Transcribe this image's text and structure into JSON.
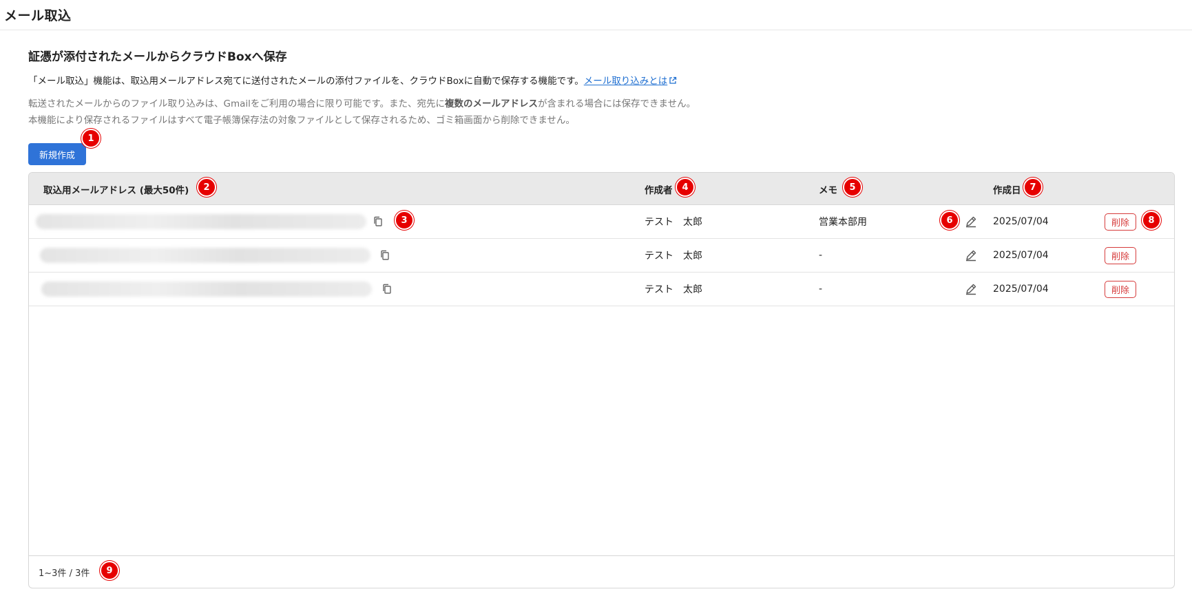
{
  "page": {
    "title": "メール取込"
  },
  "intro": {
    "heading": "証憑が添付されたメールからクラウドBoxへ保存",
    "description": "「メール取込」機能は、取込用メールアドレス宛てに送付されたメールの添付ファイルを、クラウドBoxに自動で保存する機能です。",
    "help_link": "メール取り込みとは",
    "note1_prefix": "転送されたメールからのファイル取り込みは、Gmailをご利用の場合に限り可能です。また、宛先に",
    "note1_bold": "複数のメールアドレス",
    "note1_suffix": "が含まれる場合には保存できません。",
    "note2": "本機能により保存されるファイルはすべて電子帳簿保存法の対象ファイルとして保存されるため、ゴミ箱画面から削除できません。"
  },
  "toolbar": {
    "new_label": "新規作成"
  },
  "table": {
    "headers": {
      "address": "取込用メールアドレス (最大50件)",
      "author": "作成者",
      "memo": "メモ",
      "date": "作成日"
    },
    "rows": [
      {
        "author": "テスト　太郎",
        "memo": "営業本部用",
        "date": "2025/07/04",
        "delete_label": "削除"
      },
      {
        "author": "テスト　太郎",
        "memo": "-",
        "date": "2025/07/04",
        "delete_label": "削除"
      },
      {
        "author": "テスト　太郎",
        "memo": "-",
        "date": "2025/07/04",
        "delete_label": "削除"
      }
    ],
    "pagination": "1~3件 / 3件"
  },
  "annotations": [
    "1",
    "2",
    "3",
    "4",
    "5",
    "6",
    "7",
    "8",
    "9"
  ],
  "colors": {
    "primary": "#2f73d8",
    "danger": "#d63b3b",
    "badge": "#e60000",
    "link": "#1f6fd1"
  },
  "icons": {
    "copy": "copy-icon",
    "edit": "pencil-icon",
    "external": "external-link-icon"
  }
}
